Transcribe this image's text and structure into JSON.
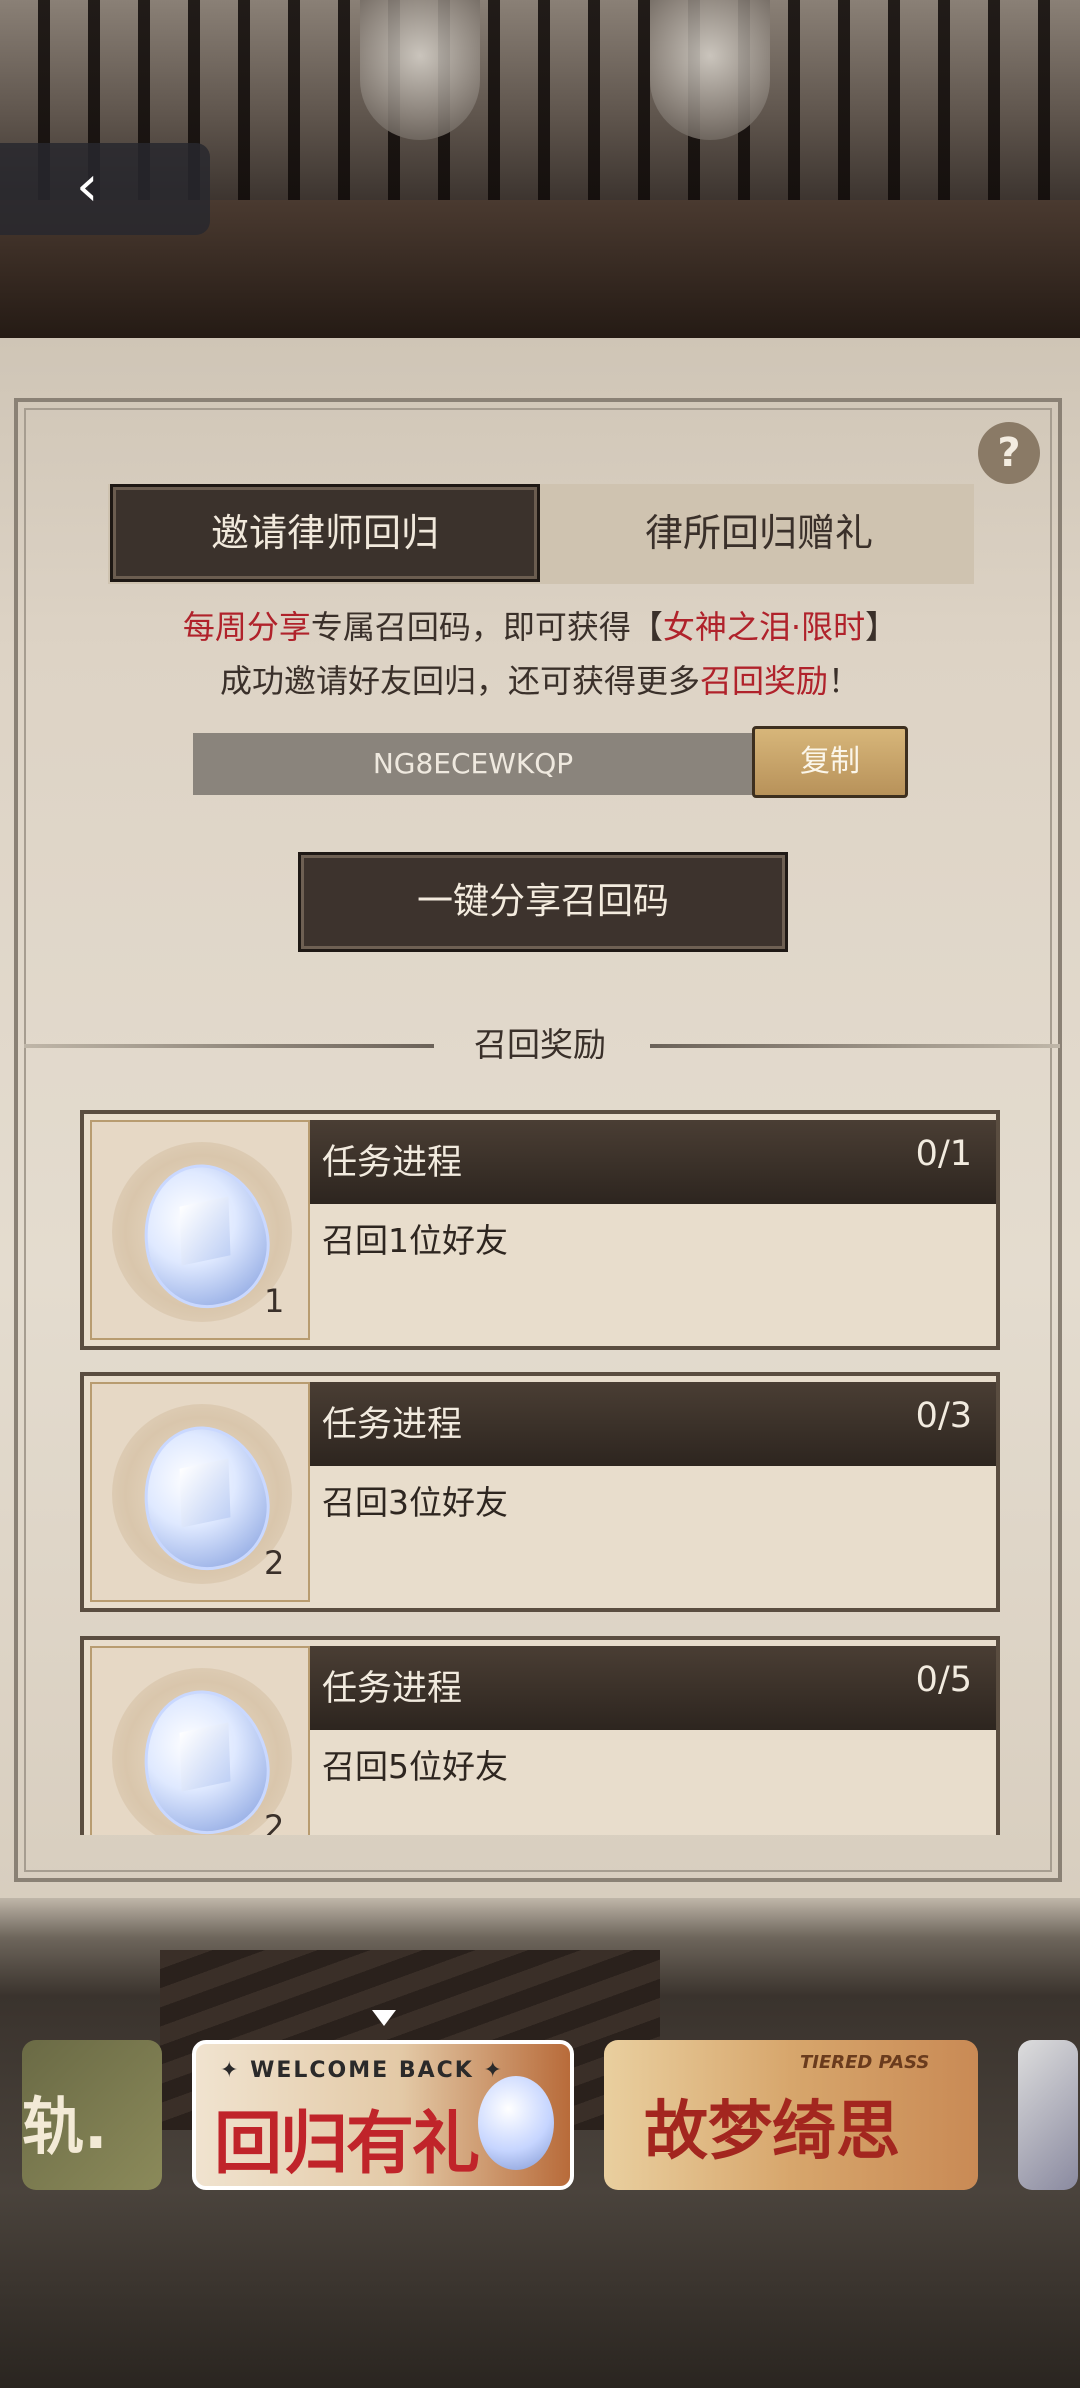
{
  "header": {
    "back_icon": "chevron-left-icon",
    "back_glyph": "‹"
  },
  "help": {
    "icon": "question-icon",
    "glyph": "?"
  },
  "tabs": [
    {
      "label": "邀请律师回归",
      "active": true
    },
    {
      "label": "律所回归赠礼",
      "active": false
    }
  ],
  "description": {
    "line1": {
      "red1": "每周分享",
      "mid": "专属召回码，即可获得【",
      "red2": "女神之泪·限时",
      "end": "】"
    },
    "line2": {
      "start": "成功邀请好友回归，还可获得更多",
      "red": "召回奖励",
      "end": "！"
    }
  },
  "invite": {
    "code": "NG8ECEWKQP",
    "copy_label": "复制",
    "share_label": "一键分享召回码"
  },
  "rewards": {
    "title": "召回奖励",
    "items": [
      {
        "progress_label": "任务进程",
        "progress": "0/1",
        "task": "召回1位好友",
        "qty": "1"
      },
      {
        "progress_label": "任务进程",
        "progress": "0/3",
        "task": "召回3位好友",
        "qty": "2"
      },
      {
        "progress_label": "任务进程",
        "progress": "0/5",
        "task": "召回5位好友",
        "qty": "2"
      }
    ]
  },
  "banners": [
    {
      "text": "轨."
    },
    {
      "small": "✦ WELCOME BACK ✦",
      "big": "回归有礼"
    },
    {
      "small": "TIERED PASS",
      "big": "故梦绮思"
    }
  ],
  "colors": {
    "accent_red": "#b0222b",
    "dark_button": "#3d332d",
    "gold_button": "#c9a56a",
    "paper": "#e4dccf"
  }
}
